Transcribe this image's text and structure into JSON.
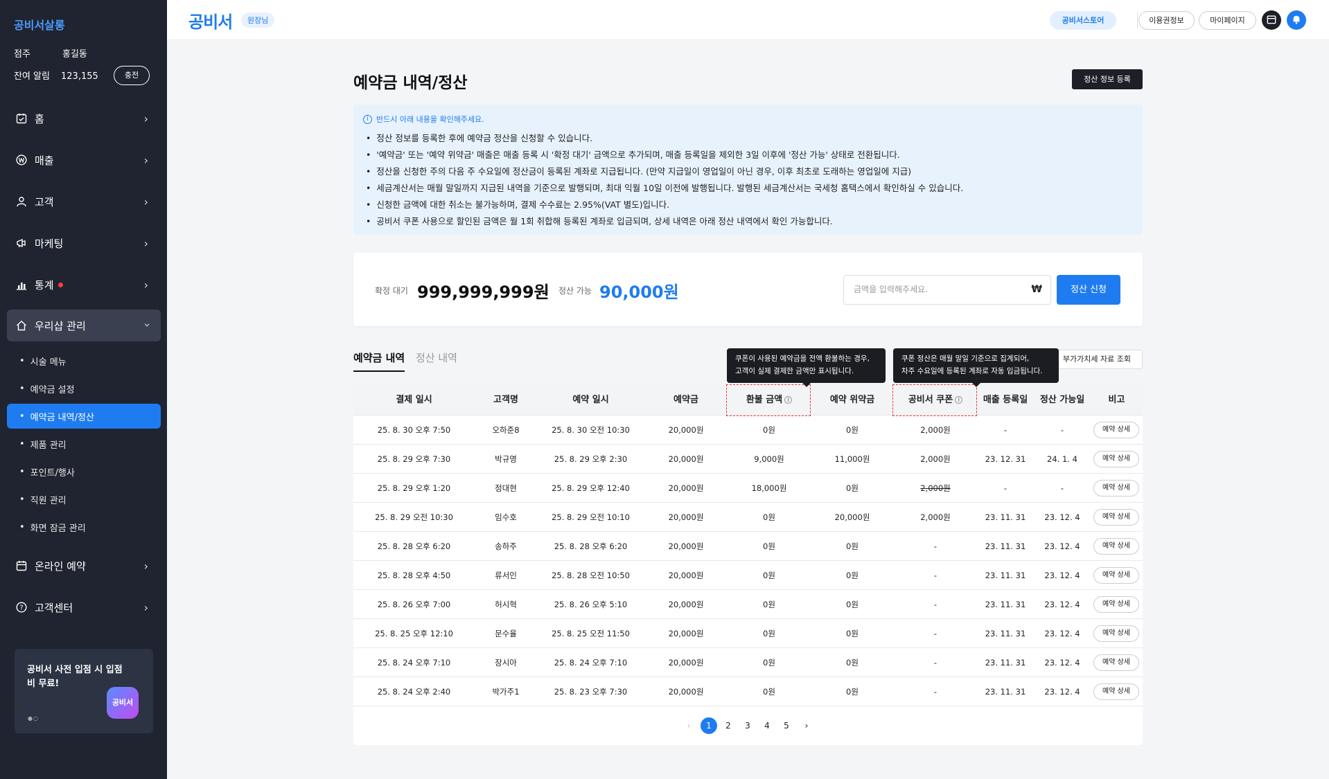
{
  "sidebar": {
    "brand": "공비서살롱",
    "owner_label": "점주",
    "owner_name": "홍길동",
    "alarm_label": "잔여 알림",
    "alarm_count": "123,155",
    "charge_label": "충전",
    "menu": [
      {
        "label": "홈",
        "icon": "calendar-check-icon"
      },
      {
        "label": "매출",
        "icon": "won-coin-icon"
      },
      {
        "label": "고객",
        "icon": "person-icon"
      },
      {
        "label": "마케팅",
        "icon": "megaphone-icon"
      },
      {
        "label": "통계",
        "icon": "chart-icon"
      },
      {
        "label": "우리샵 관리",
        "icon": "home-icon"
      },
      {
        "label": "온라인 예약",
        "icon": "calendar-icon"
      },
      {
        "label": "고객센터",
        "icon": "question-icon"
      }
    ],
    "submenu": [
      "시술 메뉴",
      "예약금 설정",
      "예약금 내역/정산",
      "제품 관리",
      "포인트/행사",
      "직원 관리",
      "화면 잠금 관리"
    ],
    "promo": {
      "text": "공비서 사전 입점 시 입점비 무료!",
      "logo": "공비서"
    }
  },
  "topbar": {
    "logo": "공비서",
    "badge": "원장님",
    "store": "공비서스토어",
    "usage": "이용권정보",
    "mypage": "마이페이지"
  },
  "page": {
    "title": "예약금 내역/정산",
    "register_btn": "정산 정보 등록"
  },
  "notice": {
    "head": "반드시 아래 내용을 확인해주세요.",
    "items": [
      "정산 정보를 등록한 후에 예약금 정산을 신청할 수 있습니다.",
      "'예약금' 또는 '예약 위약금' 매출은 매출 등록 시 '확정 대기' 금액으로 추가되며, 매출 등록일을 제외한 3일 이후에 '정산 가능' 상태로 전환됩니다.",
      "정산을 신청한 주의 다음 주 수요일에 정산금이 등록된 계좌로 지급됩니다. (만약 지급일이 영업일이 아닌 경우, 이후 최초로 도래하는 영업일에 지급)",
      "세금계산서는 매월 말일까지 지급된 내역을 기준으로 발행되며, 최대 익월 10일 이전에 발행됩니다. 발행된 세금계산서는 국세청 홈택스에서 확인하실 수 있습니다.",
      "신청한 금액에 대한 취소는 불가능하며, 결제 수수료는 2.95%(VAT 별도)입니다.",
      "공비서 쿠폰 사용으로 할인된 금액은 월 1회 취합해 등록된 계좌로 입금되며, 상세 내역은 아래 정산 내역에서 확인 가능합니다."
    ]
  },
  "summary": {
    "pending_label": "확정 대기",
    "pending_value": "999,999,999원",
    "available_label": "정산 가능",
    "available_value": "90,000원",
    "input_placeholder": "금액을 입력해주세요.",
    "currency": "₩",
    "apply_btn": "정산 신청"
  },
  "tabs": {
    "active": "예약금 내역",
    "inactive": "정산 내역",
    "vat_btn": "부가가치세 자료 조회"
  },
  "tooltips": {
    "refund": "쿠폰이 사용된 예약금을 전액 환불하는 경우,\n고객이 실제 결제한 금액만 표시됩니다.",
    "coupon": "쿠폰 정산은 매월 말일 기준으로 집계되어,\n차주 수요일에 등록된 계좌로 자동 입금됩니다."
  },
  "table": {
    "columns": [
      "결제 일시",
      "고객명",
      "예약 일시",
      "예약금",
      "환불 금액",
      "예약 위약금",
      "공비서 쿠폰",
      "매출 등록일",
      "정산 가능일",
      "비고"
    ],
    "detail_label": "예약 상세",
    "rows": [
      [
        "25. 8. 30 오후 7:50",
        "오하준8",
        "25. 8. 30 오전 10:30",
        "20,000원",
        "0원",
        "0원",
        "2,000원",
        "-",
        "-"
      ],
      [
        "25. 8. 29 오후 7:30",
        "박규영",
        "25. 8. 29 오후 2:30",
        "20,000원",
        "9,000원",
        "11,000원",
        "2,000원",
        "23. 12. 31",
        "24. 1. 4"
      ],
      [
        "25. 8. 29 오후 1:20",
        "정대현",
        "25. 8. 29 오후 12:40",
        "20,000원",
        "18,000원",
        "0원",
        "2,000원",
        "-",
        "-"
      ],
      [
        "25. 8. 29 오전 10:30",
        "임수호",
        "25. 8. 29 오전 10:10",
        "20,000원",
        "0원",
        "20,000원",
        "2,000원",
        "23. 11. 31",
        "23. 12. 4"
      ],
      [
        "25. 8. 28 오후 6:20",
        "송하주",
        "25. 8. 28 오후 6:20",
        "20,000원",
        "0원",
        "0원",
        "-",
        "23. 11. 31",
        "23. 12. 4"
      ],
      [
        "25. 8. 28 오후 4:50",
        "류서인",
        "25. 8. 28 오전 10:50",
        "20,000원",
        "0원",
        "0원",
        "-",
        "23. 11. 31",
        "23. 12. 4"
      ],
      [
        "25. 8. 26 오후 7:00",
        "허시혁",
        "25. 8. 26 오후 5:10",
        "20,000원",
        "0원",
        "0원",
        "-",
        "23. 11. 31",
        "23. 12. 4"
      ],
      [
        "25. 8. 25 오후 12:10",
        "문수율",
        "25. 8. 25 오전 11:50",
        "20,000원",
        "0원",
        "0원",
        "-",
        "23. 11. 31",
        "23. 12. 4"
      ],
      [
        "25. 8. 24 오후 7:10",
        "장시아",
        "25. 8. 24 오후 7:10",
        "20,000원",
        "0원",
        "0원",
        "-",
        "23. 11. 31",
        "23. 12. 4"
      ],
      [
        "25. 8. 24 오후 2:40",
        "박가주1",
        "25. 8. 23 오후 7:30",
        "20,000원",
        "0원",
        "0원",
        "-",
        "23. 11. 31",
        "23. 12. 4"
      ]
    ],
    "struck_cell": {
      "row": 2,
      "col": 6
    }
  },
  "pagination": {
    "prev": "‹",
    "pages": [
      "1",
      "2",
      "3",
      "4",
      "5"
    ],
    "current": "1",
    "next": "›"
  },
  "colors": {
    "accent": "#1f7cf0",
    "sidebar": "#1f2430",
    "notice_bg": "#e8f2fd"
  }
}
